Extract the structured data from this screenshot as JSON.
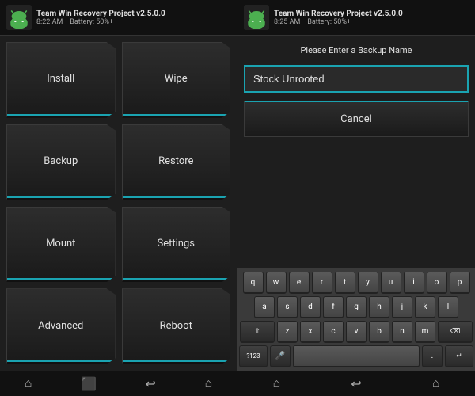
{
  "left": {
    "header": {
      "title": "Team Win Recovery Project  v2.5.0.0",
      "time": "8:22 AM",
      "battery": "Battery: 50%+"
    },
    "buttons": [
      {
        "label": "Install",
        "id": "install"
      },
      {
        "label": "Wipe",
        "id": "wipe"
      },
      {
        "label": "Backup",
        "id": "backup"
      },
      {
        "label": "Restore",
        "id": "restore"
      },
      {
        "label": "Mount",
        "id": "mount"
      },
      {
        "label": "Settings",
        "id": "settings"
      },
      {
        "label": "Advanced",
        "id": "advanced"
      },
      {
        "label": "Reboot",
        "id": "reboot"
      }
    ],
    "nav": [
      "🏠",
      "⬛",
      "↩",
      "⌂"
    ]
  },
  "right": {
    "header": {
      "title": "Team Win Recovery Project  v2.5.0.0",
      "time": "8:25 AM",
      "battery": "Battery: 50%+"
    },
    "prompt": "Please Enter a Backup Name",
    "input_value": "Stock Unrooted",
    "cancel_label": "Cancel",
    "keyboard": {
      "rows": [
        [
          "q",
          "w",
          "e",
          "r",
          "t",
          "y",
          "u",
          "i",
          "o",
          "p"
        ],
        [
          "a",
          "s",
          "d",
          "f",
          "g",
          "h",
          "j",
          "k",
          "l"
        ],
        [
          "z",
          "x",
          "c",
          "v",
          "b",
          "n",
          "m"
        ]
      ],
      "special": {
        "shift": "⇧",
        "backspace": "⌫",
        "num": "?123",
        "mic": "🎤",
        "dot": ".",
        "enter": "↵"
      }
    },
    "nav": [
      "🏠",
      "↩",
      "⌂"
    ]
  }
}
